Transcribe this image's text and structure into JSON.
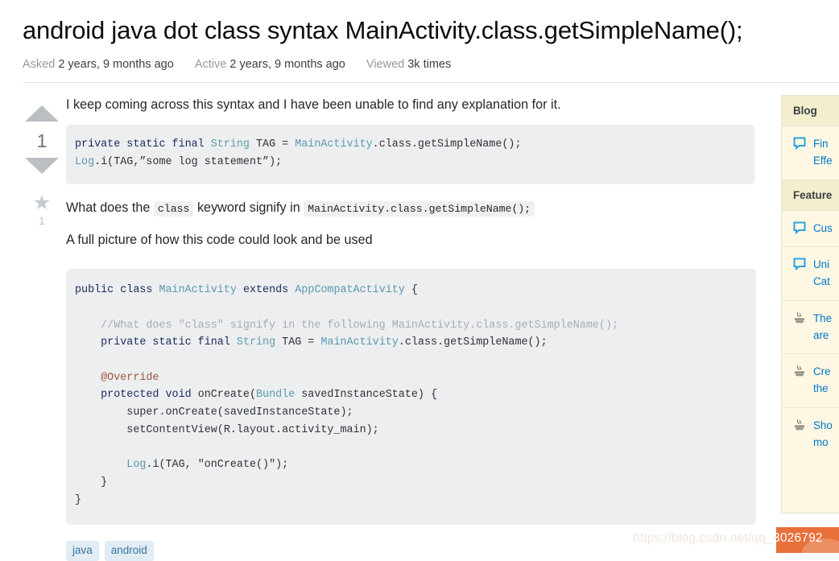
{
  "question": {
    "title": "android java dot class syntax MainActivity.class.getSimpleName();",
    "stats": [
      {
        "label": "Asked",
        "value": "2 years, 9 months ago"
      },
      {
        "label": "Active",
        "value": "2 years, 9 months ago"
      },
      {
        "label": "Viewed",
        "value": "3k times"
      }
    ]
  },
  "votes": {
    "up_icon": "triangle-up-icon",
    "down_icon": "triangle-down-icon",
    "count": "1",
    "favorite_icon": "star-icon",
    "favorite_count": "1"
  },
  "post": {
    "paragraph_1": "I keep coming across this syntax and I have been unable to find any explanation for it.",
    "question_line": {
      "before": "What does the ",
      "code_1": "class",
      "middle": " keyword signify in ",
      "code_2": "MainActivity.class.getSimpleName();"
    },
    "paragraph_2": "A full picture of how this code could look and be used",
    "code_1": {
      "line_1": {
        "kw1": "private static final ",
        "type": "String",
        "mid": " TAG = ",
        "cls": "MainActivity",
        "tail": ".class.getSimpleName();"
      },
      "line_2": {
        "cls": "Log",
        "tail": ".i(TAG,”some log statement”);"
      }
    },
    "code_2": {
      "l1_kw": "public class ",
      "l1_cls": "MainActivity",
      "l1_kw2": " extends ",
      "l1_cls2": "AppCompatActivity",
      "l1_tail": " {",
      "l2": "",
      "l3_cmt": "    //What does \"class\" signify in the following MainActivity.class.getSimpleName();",
      "l4_kw": "    private static final ",
      "l4_type": "String",
      "l4_mid": " TAG = ",
      "l4_cls": "MainActivity",
      "l4_tail": ".class.getSimpleName();",
      "l5": "",
      "l6_ann": "    @Override",
      "l7_kw": "    protected void ",
      "l7_plain": "onCreate(",
      "l7_cls": "Bundle",
      "l7_tail": " savedInstanceState) {",
      "l8": "        super.onCreate(savedInstanceState);",
      "l9": "        setContentView(R.layout.activity_main);",
      "l10": "",
      "l11_cls": "        Log",
      "l11_mid": ".i(TAG, ",
      "l11_str": "\"onCreate()\"",
      "l11_tail": ");",
      "l12": "    }",
      "l13": "}"
    },
    "tags": [
      "java",
      "android"
    ]
  },
  "sidebar": {
    "sections": [
      {
        "header": "Blog",
        "items": [
          {
            "icon": "speech-bubble-icon",
            "line1": "Fin",
            "line2": "Effe"
          }
        ]
      },
      {
        "header": "Feature",
        "items": [
          {
            "icon": "speech-bubble-icon",
            "line1": "Cus",
            "line2": ""
          },
          {
            "icon": "speech-bubble-icon",
            "line1": "Uni",
            "line2": "Cat"
          },
          {
            "icon": "hot-meta-icon",
            "line1": "The",
            "line2": "are"
          },
          {
            "icon": "hot-meta-icon",
            "line1": "Cre",
            "line2": "the"
          },
          {
            "icon": "hot-meta-icon",
            "line1": "Sho",
            "line2": "mo"
          }
        ]
      }
    ]
  },
  "watermark": {
    "url": "https://blog.csdn.net/qq_4",
    "badge_number": "3026792"
  }
}
